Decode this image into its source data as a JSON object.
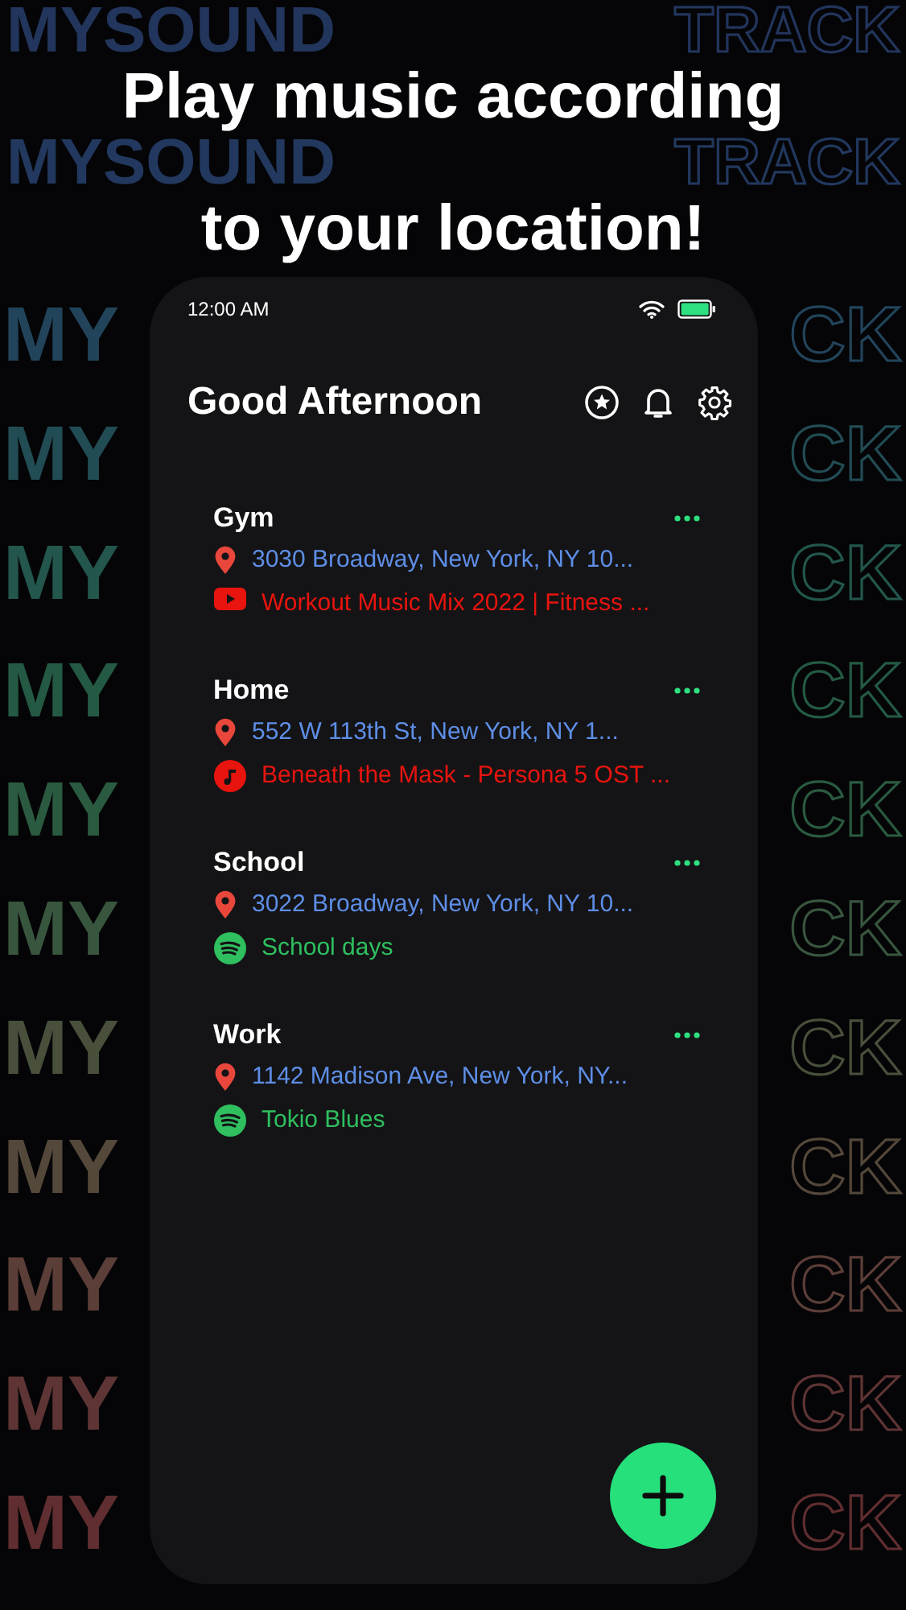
{
  "background_rows": [
    {
      "left": "MYSOUND",
      "right": "TRACK",
      "color": "#22355c"
    },
    {
      "left": "MYSOUND",
      "right": "TRACK",
      "color": "#22385e"
    },
    {
      "left": "MY",
      "right": "CK",
      "color": "#22445a"
    },
    {
      "left": "MY",
      "right": "CK",
      "color": "#224c54"
    },
    {
      "left": "MY",
      "right": "CK",
      "color": "#23564c"
    },
    {
      "left": "MY",
      "right": "CK",
      "color": "#245a44"
    },
    {
      "left": "MY",
      "right": "CK",
      "color": "#2a5a40"
    },
    {
      "left": "MY",
      "right": "CK",
      "color": "#38563e"
    },
    {
      "left": "MY",
      "right": "CK",
      "color": "#48503c"
    },
    {
      "left": "MY",
      "right": "CK",
      "color": "#54483a"
    },
    {
      "left": "MY",
      "right": "CK",
      "color": "#5c3e38"
    },
    {
      "left": "MY",
      "right": "CK",
      "color": "#5e3434"
    },
    {
      "left": "MY",
      "right": "CK",
      "color": "#602e30"
    }
  ],
  "headline_lines": [
    "Play music according",
    "to your location!"
  ],
  "phone": {
    "status_bar": {
      "time": "12:00 AM"
    },
    "greeting": "Good Afternoon",
    "locations": [
      {
        "name": "Gym",
        "address": "3030 Broadway, New York, NY 10...",
        "track": "Workout Music Mix 2022 | Fitness ...",
        "kind": "youtube"
      },
      {
        "name": "Home",
        "address": "552 W 113th St, New York, NY 1...",
        "track": "Beneath the Mask - Persona 5 OST ...",
        "kind": "music"
      },
      {
        "name": "School",
        "address": "3022 Broadway, New York, NY 10...",
        "track": "School days",
        "kind": "spotify"
      },
      {
        "name": "Work",
        "address": "1142 Madison Ave, New York, NY...",
        "track": "Tokio Blues",
        "kind": "spotify"
      }
    ]
  }
}
